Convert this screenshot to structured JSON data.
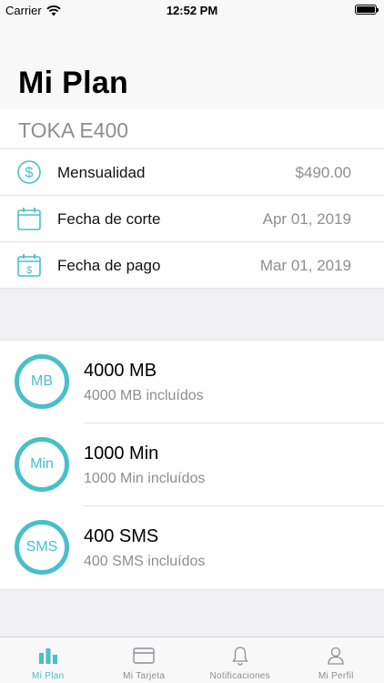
{
  "status_bar": {
    "carrier": "Carrier",
    "time": "12:52 PM",
    "battery_level": 1.0
  },
  "header": {
    "title": "Mi Plan"
  },
  "plan": {
    "name": "TOKA E400",
    "rows": [
      {
        "icon": "dollar-circle-icon",
        "label": "Mensualidad",
        "value": "$490.00"
      },
      {
        "icon": "calendar-icon",
        "label": "Fecha de corte",
        "value": "Apr 01, 2019"
      },
      {
        "icon": "calendar-dollar-icon",
        "label": "Fecha de pago",
        "value": "Mar 01, 2019"
      }
    ]
  },
  "usage": [
    {
      "ring": "MB",
      "title": "4000 MB",
      "subtitle": "4000 MB incluídos"
    },
    {
      "ring": "Min",
      "title": "1000 Min",
      "subtitle": "1000 Min incluídos"
    },
    {
      "ring": "SMS",
      "title": "400 SMS",
      "subtitle": "400 SMS incluídos"
    }
  ],
  "tabs": [
    {
      "label": "Mi Plan",
      "icon": "bar-chart-icon",
      "active": true
    },
    {
      "label": "Mi Tarjeta",
      "icon": "credit-card-icon",
      "active": false
    },
    {
      "label": "Notificaciones",
      "icon": "bell-icon",
      "active": false
    },
    {
      "label": "Mi Perfil",
      "icon": "person-icon",
      "active": false
    }
  ],
  "colors": {
    "accent": "#48bfcb",
    "secondary_text": "#8e8e93",
    "background": "#efeff4"
  }
}
